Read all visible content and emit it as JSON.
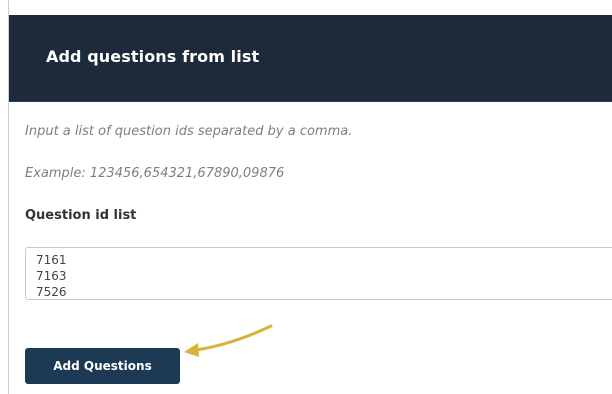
{
  "modal": {
    "title": "Add questions from list",
    "instruction": "Input a list of question ids separated by a comma.",
    "example": "Example: 123456,654321,67890,09876",
    "field_label": "Question id list",
    "question_ids": [
      "7161",
      "7163",
      "7526"
    ],
    "submit_label": "Add Questions"
  },
  "colors": {
    "header_bg": "#1d2a3b",
    "button_bg": "#1d3a55",
    "annotation_arrow": "#d9b23a"
  }
}
